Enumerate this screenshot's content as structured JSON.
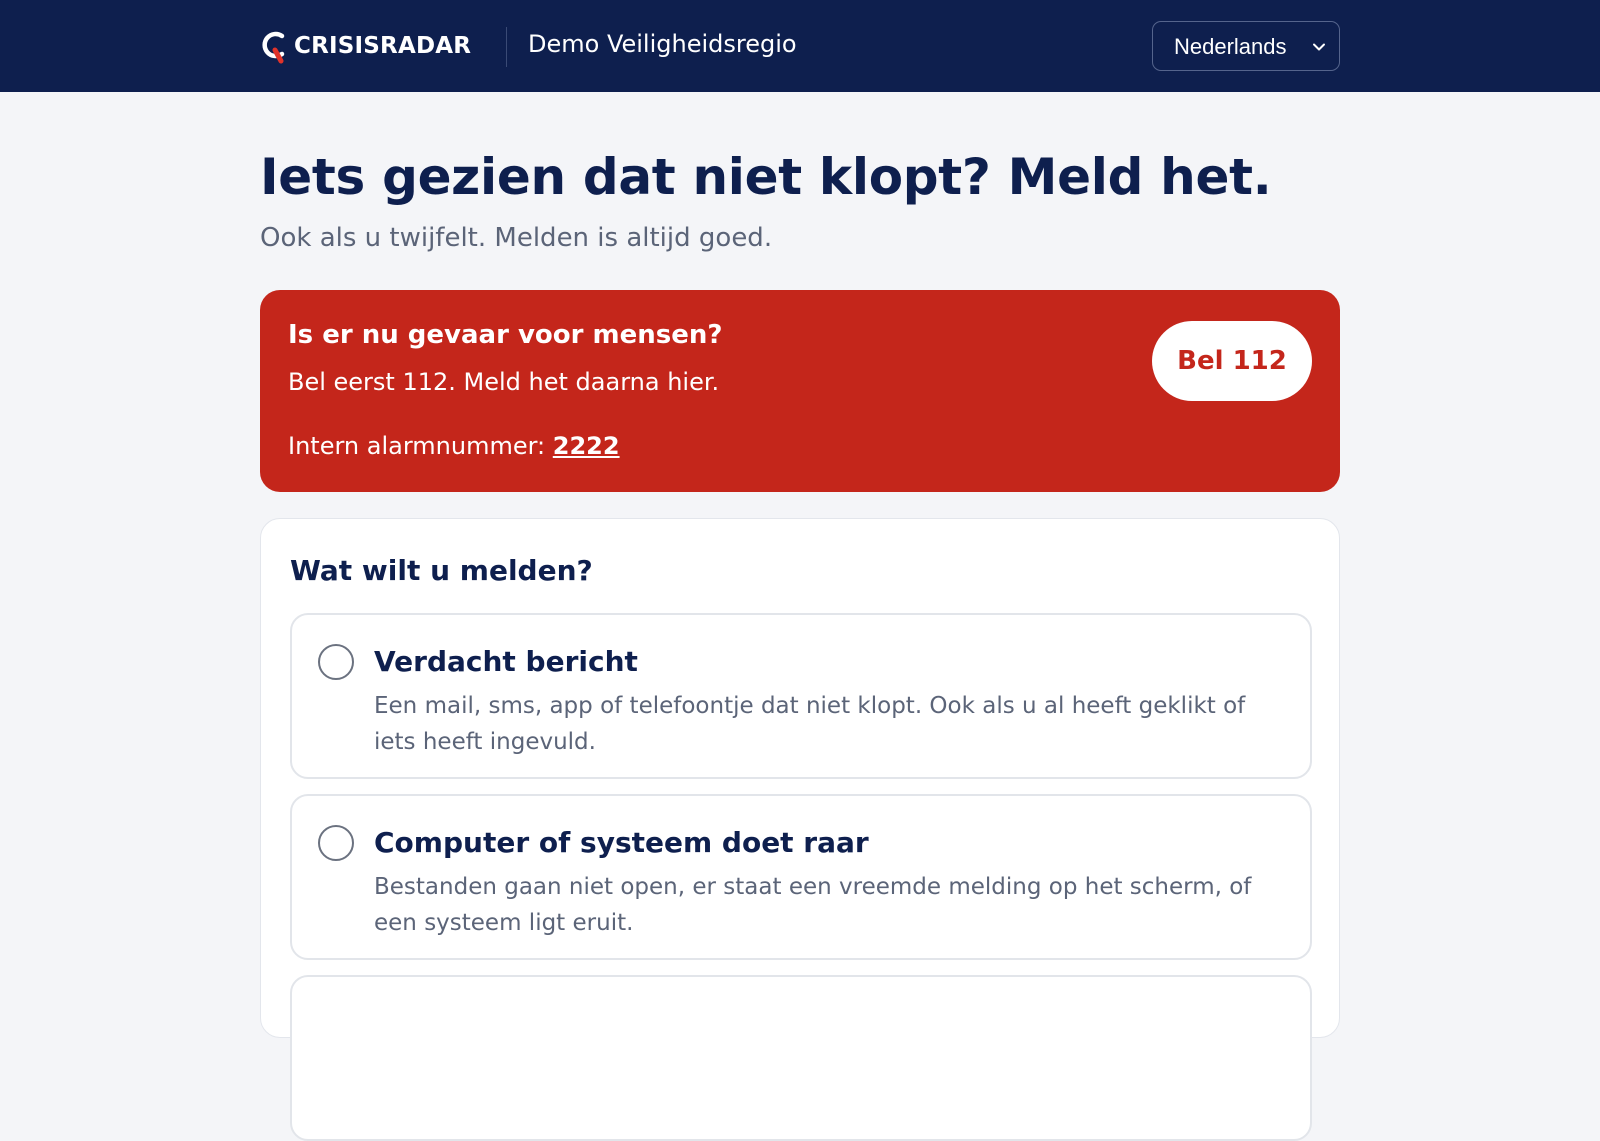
{
  "header": {
    "logo_text": "CRISISRADAR",
    "region_name": "Demo Veiligheidsregio",
    "language": {
      "selected": "Nederlands",
      "icon": "chevron-down-icon"
    }
  },
  "main": {
    "title": "Iets gezien dat niet klopt? Meld het.",
    "subtitle": "Ook als u twijfelt. Melden is altijd goed."
  },
  "danger": {
    "heading": "Is er nu gevaar voor mensen?",
    "text": "Bel eerst 112. Meld het daarna hier.",
    "internal_label": "Intern alarmnummer:",
    "internal_number": "2222",
    "call_button": "Bel 112"
  },
  "report": {
    "question": "Wat wilt u melden?",
    "options": [
      {
        "title": "Verdacht bericht",
        "description": "Een mail, sms, app of telefoontje dat niet klopt. Ook als u al heeft geklikt of iets heeft ingevuld."
      },
      {
        "title": "Computer of systeem doet raar",
        "description": "Bestanden gaan niet open, er staat een vreemde melding op het scherm, of een systeem ligt eruit."
      }
    ]
  },
  "colors": {
    "navy": "#0e1f4e",
    "danger_red": "#c4261b",
    "background": "#f4f5f8",
    "muted_text": "#5b6478"
  }
}
